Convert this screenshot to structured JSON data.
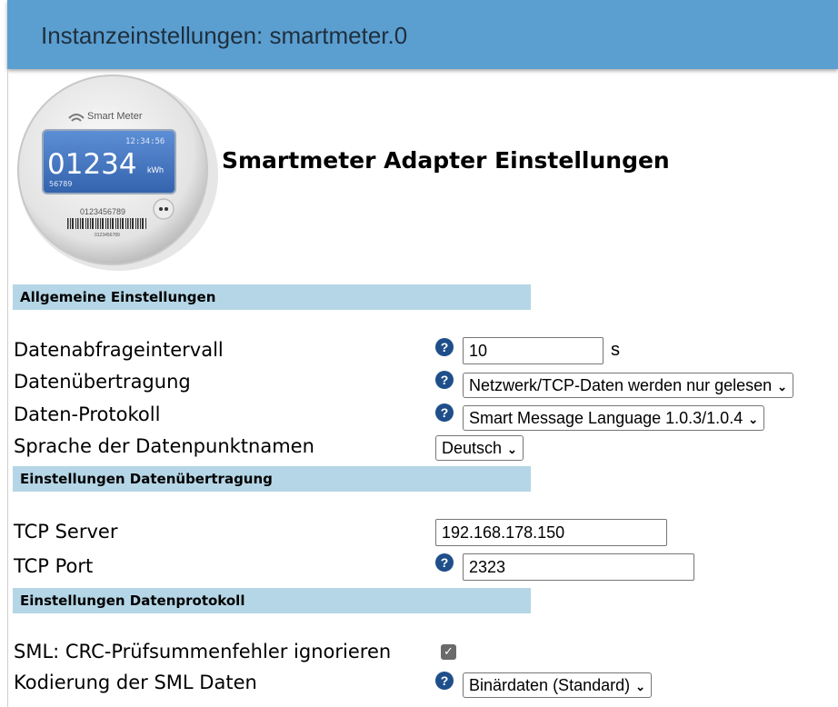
{
  "header": {
    "title": "Instanzeinstellungen: smartmeter.0"
  },
  "meter_image": {
    "brand": "Smart Meter",
    "time": "12:34:56",
    "reading": "01234",
    "unit": "kWh",
    "sub": "56789",
    "barcode_number": "0123456789",
    "barcode_small": "0123456789"
  },
  "page_title": "Smartmeter Adapter Einstellungen",
  "sections": {
    "general": "Allgemeine Einstellungen",
    "transmission": "Einstellungen Datenübertragung",
    "protocol": "Einstellungen Datenprotokoll"
  },
  "fields": {
    "interval": {
      "label": "Datenabfrageintervall",
      "value": "10",
      "unit": "s"
    },
    "transfer": {
      "label": "Datenübertragung",
      "value": "Netzwerk/TCP-Daten werden nur gelesen"
    },
    "protocol": {
      "label": "Daten-Protokoll",
      "value": "Smart Message Language 1.0.3/1.0.4"
    },
    "language": {
      "label": "Sprache der Datenpunktnamen",
      "value": "Deutsch"
    },
    "tcp_server": {
      "label": "TCP Server",
      "value": "192.168.178.150"
    },
    "tcp_port": {
      "label": "TCP Port",
      "value": "2323"
    },
    "crc_ignore": {
      "label": "SML: CRC-Prüfsummenfehler ignorieren",
      "checked": true
    },
    "encoding": {
      "label": "Kodierung der SML Daten",
      "value": "Binärdaten (Standard)"
    }
  },
  "icons": {
    "help": "help-circle-icon",
    "dropdown": "chevron-down-icon",
    "check": "checkmark-icon"
  },
  "colors": {
    "header_bg": "#5b9fd1",
    "section_bg": "#b5d6e6",
    "help_icon": "#1e4f8a"
  }
}
